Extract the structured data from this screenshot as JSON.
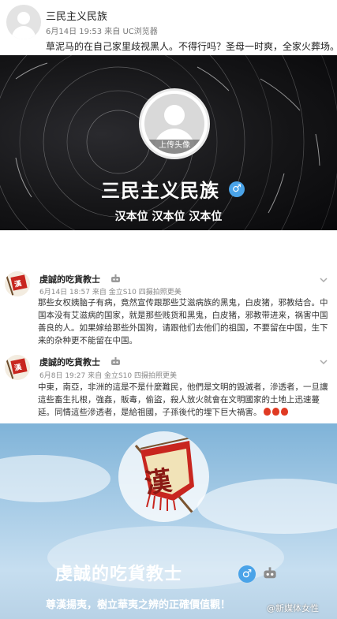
{
  "post1": {
    "username": "三民主义民族",
    "meta": "6月14日 19:53 来自 UC浏览器",
    "text": "草泥马的在自己家里歧视黑人。不得行吗？圣母一时爽，全家火葬场。"
  },
  "banner": {
    "upload_label": "上传头像",
    "name": "三民主义民族",
    "gender_symbol": "♂",
    "bio": "汉本位 汉本位 汉本位"
  },
  "comments": [
    {
      "username": "虔誠的吃貨教士",
      "meta": "6月14日 18:57 来自 金立S10 四摄拍照更美",
      "text": "那些女权姨脑子有病，竟然宣传跟那些艾滋病族的黑鬼，白皮猪，邪教结合。中国本没有艾滋病的国家，就是那些贱货和黑鬼，白皮猪，邪教带进来，祸害中国善良的人。如果嫁给那些外国狗，请跟他们去他们的祖国，不要留在中国，生下来的杂种更不能留在中国。"
    },
    {
      "username": "虔誠的吃貨教士",
      "meta": "6月8日 19:27 来自 金立S10 四摄拍照更美",
      "text": "中東，南亞，非洲的這是不是什麼難民，他們是文明的毀滅者，滲透者，一旦讓這些畜生扎根，強姦，販毒，偷盜，殺人放火就會在文明國家的土地上迅速蔓延。同情這些滲透者，是給祖國，子孫後代的埋下巨大禍害。"
    }
  ],
  "profile2": {
    "flag_char": "漢",
    "name": "虔誠的吃貨教士",
    "gender_symbol": "♂",
    "bio": "尊漢揚夷，樹立華夷之辨的正確價值觀！"
  },
  "watermark": "@新媒体女性",
  "colors": {
    "accent_blue": "#4aa3e8",
    "flag_red": "#c8261f",
    "sky_blue": "#a6cbe6"
  }
}
